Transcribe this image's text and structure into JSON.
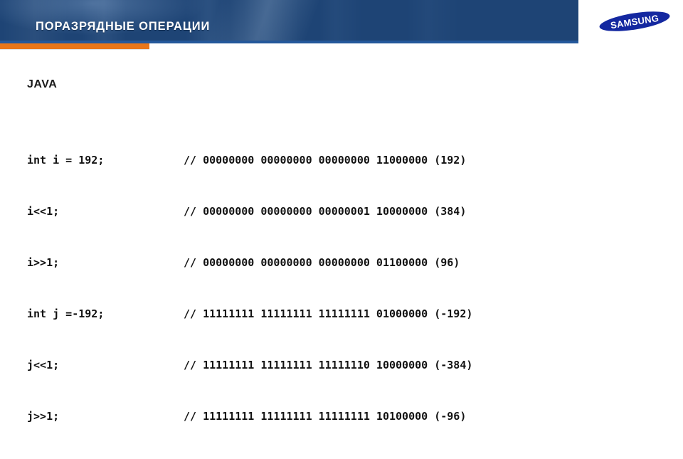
{
  "slide": {
    "title": "ПОРАЗРЯДНЫЕ ОПЕРАЦИИ",
    "language_heading": "JAVA",
    "brand": "SAMSUNG",
    "colors": {
      "header_blue": "#1e4475",
      "accent_orange": "#e8761a",
      "logo_blue": "#1428a0",
      "text_black": "#121212",
      "background": "#ffffff"
    }
  },
  "code": {
    "rows": [
      {
        "statement": "int i = 192;",
        "comment": "// 00000000 00000000 00000000 11000000 (192)"
      },
      {
        "statement": "i<<1;",
        "comment": "// 00000000 00000000 00000001 10000000 (384)"
      },
      {
        "statement": "i>>1;",
        "comment": "// 00000000 00000000 00000000 01100000 (96)"
      },
      {
        "statement": "int j =-192;",
        "comment": "// 11111111 11111111 11111111 01000000 (-192)"
      },
      {
        "statement": "j<<1;",
        "comment": "// 11111111 11111111 11111110 10000000 (-384)"
      },
      {
        "statement": "j>>1;",
        "comment": "// 11111111 11111111 11111111 10100000 (-96)"
      }
    ]
  }
}
